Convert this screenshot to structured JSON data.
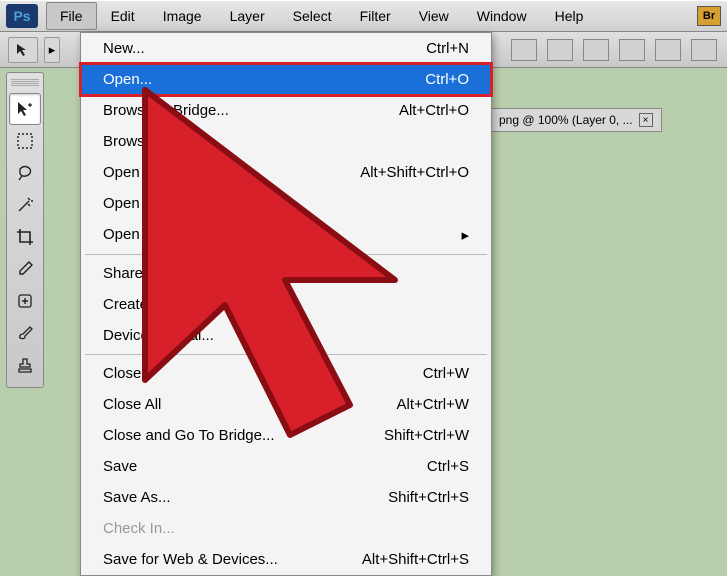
{
  "app": {
    "logo": "Ps",
    "badge": "Br"
  },
  "menubar": [
    "File",
    "Edit",
    "Image",
    "Layer",
    "Select",
    "Filter",
    "View",
    "Window",
    "Help"
  ],
  "activeMenu": "File",
  "optionsPointer": "▸",
  "docTab": {
    "label": "png @ 100% (Layer 0, ...",
    "close": "×"
  },
  "dropdown": {
    "groups": [
      [
        {
          "label": "New...",
          "shortcut": "Ctrl+N"
        },
        {
          "label": "Open...",
          "shortcut": "Ctrl+O",
          "highlighted": true
        },
        {
          "label": "Browse in Bridge...",
          "shortcut": "Alt+Ctrl+O"
        },
        {
          "label": "Browse in",
          "shortcut": ""
        },
        {
          "label": "Open As...",
          "shortcut": "Alt+Shift+Ctrl+O"
        },
        {
          "label": "Open As Smart Object...",
          "shortcut": ""
        },
        {
          "label": "Open Recent",
          "shortcut": "",
          "submenu": true
        }
      ],
      [
        {
          "label": "Share My Screen...",
          "shortcut": ""
        },
        {
          "label": "Create New Review...",
          "shortcut": ""
        },
        {
          "label": "Device Central...",
          "shortcut": ""
        }
      ],
      [
        {
          "label": "Close",
          "shortcut": "Ctrl+W"
        },
        {
          "label": "Close All",
          "shortcut": "Alt+Ctrl+W"
        },
        {
          "label": "Close and Go To Bridge...",
          "shortcut": "Shift+Ctrl+W"
        },
        {
          "label": "Save",
          "shortcut": "Ctrl+S"
        },
        {
          "label": "Save As...",
          "shortcut": "Shift+Ctrl+S"
        },
        {
          "label": "Check In...",
          "shortcut": "",
          "disabled": true
        },
        {
          "label": "Save for Web & Devices...",
          "shortcut": "Alt+Shift+Ctrl+S"
        }
      ]
    ]
  },
  "tools": [
    "move",
    "marquee",
    "lasso",
    "wand",
    "crop",
    "eyedropper",
    "heal",
    "brush",
    "stamp"
  ]
}
